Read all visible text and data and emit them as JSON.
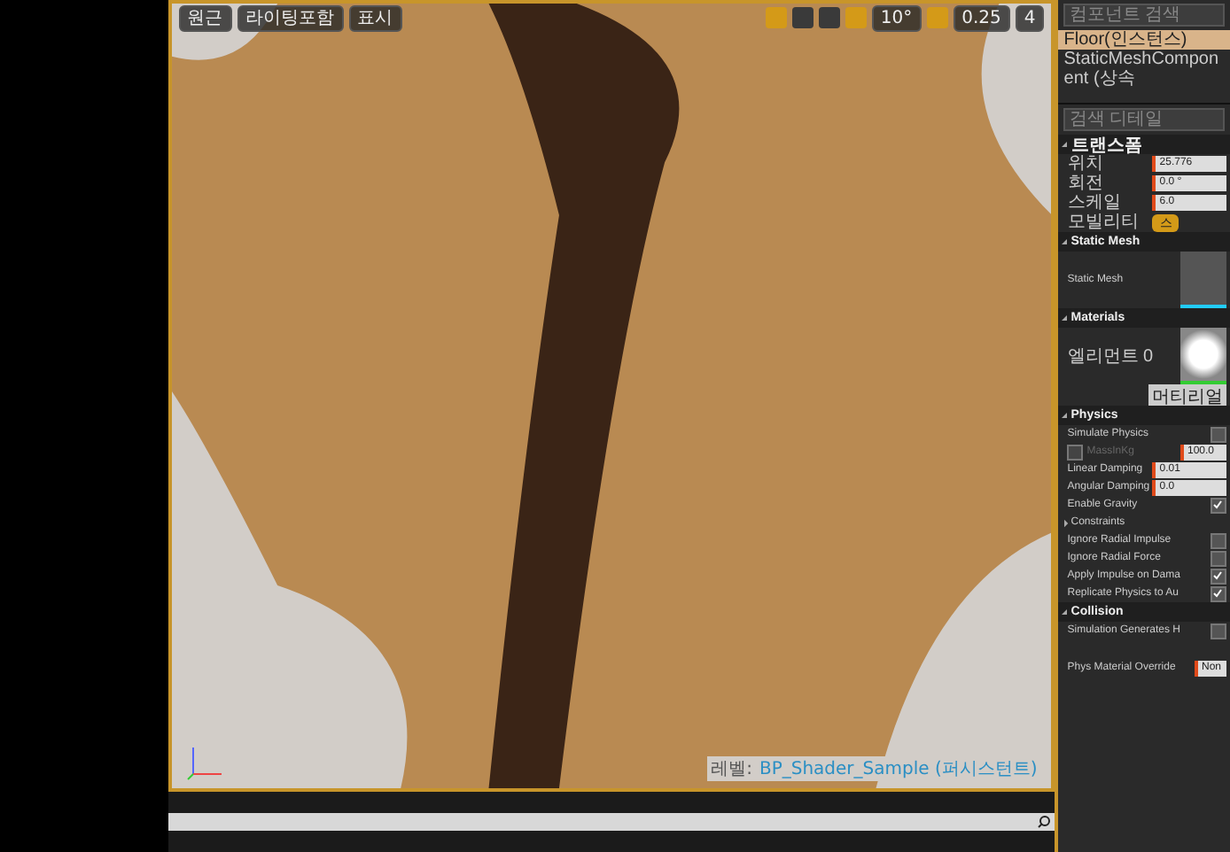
{
  "toolbar": {
    "buttons": [
      {
        "label": "원근"
      },
      {
        "label": "라이팅포함"
      },
      {
        "label": "표시"
      }
    ],
    "rotation_snap": "10°",
    "scale_snap": "0.25",
    "camera_speed": "4"
  },
  "viewport": {
    "level_label": "레벨:",
    "level_name": "BP_Shader_Sample (퍼시스턴트)"
  },
  "details": {
    "component_search": {
      "placeholder": "컴포넌트 검색"
    },
    "components": [
      {
        "name": "Floor(인스턴스)",
        "selected": true
      },
      {
        "name": "StaticMeshComponent (상속",
        "selected": false
      }
    ],
    "detail_search": {
      "placeholder": "검색 디테일"
    },
    "sections": [
      {
        "title": "트랜스폼",
        "expanded": true,
        "rows": [
          {
            "kind": "value",
            "label": "위치",
            "value": "25.776"
          },
          {
            "kind": "value",
            "label": "회전",
            "value": "0.0 °"
          },
          {
            "kind": "value",
            "label": "스케일",
            "value": "6.0"
          },
          {
            "kind": "button",
            "label": "모빌리티",
            "value": "스"
          }
        ]
      },
      {
        "title": "Static Mesh",
        "expanded": true,
        "rows": [
          {
            "kind": "thumb",
            "label": "Static Mesh"
          }
        ]
      },
      {
        "title": "Materials",
        "expanded": true,
        "rows": [
          {
            "kind": "thumb",
            "label": "엘리먼트 0"
          },
          {
            "kind": "button",
            "label": "",
            "value": "머티리얼"
          }
        ]
      },
      {
        "title": "Physics",
        "expanded": true,
        "rows": [
          {
            "kind": "check",
            "label": "Simulate Physics",
            "checked": false
          },
          {
            "kind": "checkvalue",
            "label": "MassInKg",
            "checked": false,
            "disabled": true,
            "value": "100.0"
          },
          {
            "kind": "value",
            "label": "Linear Damping",
            "value": "0.01"
          },
          {
            "kind": "value",
            "label": "Angular Damping",
            "value": "0.0"
          },
          {
            "kind": "check",
            "label": "Enable Gravity",
            "checked": true
          },
          {
            "kind": "group",
            "label": "Constraints",
            "expanded": false
          },
          {
            "kind": "check",
            "label": "Ignore Radial Impulse",
            "checked": false
          },
          {
            "kind": "check",
            "label": "Ignore Radial Force",
            "checked": false
          },
          {
            "kind": "check",
            "label": "Apply Impulse on Dama",
            "checked": true
          },
          {
            "kind": "check",
            "label": "Replicate Physics to Au",
            "checked": true
          }
        ]
      },
      {
        "title": "Collision",
        "expanded": true,
        "rows": [
          {
            "kind": "check",
            "label": "Simulation Generates H",
            "checked": false
          },
          {
            "kind": "thumbvalue",
            "label": "Phys Material Override",
            "value": "Non"
          }
        ]
      }
    ]
  }
}
